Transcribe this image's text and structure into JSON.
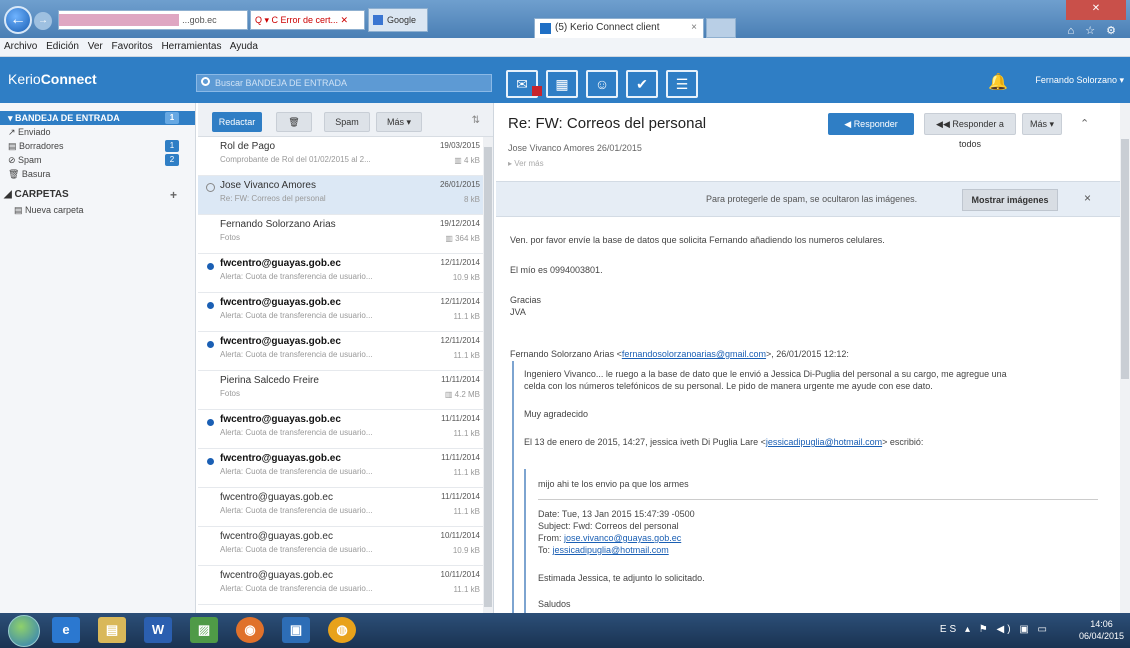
{
  "browser": {
    "address_text": "...gob.ec",
    "address_tools": "Q ▾ C Error de cert... ✕",
    "tab_google": "Google",
    "tab_kerio": "(5) Kerio Connect client",
    "tab_close": "×",
    "back_glyph": "←",
    "forward_glyph": "→"
  },
  "menubar": [
    "Archivo",
    "Edición",
    "Ver",
    "Favoritos",
    "Herramientas",
    "Ayuda"
  ],
  "app": {
    "logo_prefix": "Kerio",
    "logo_suffix": "Connect",
    "search_placeholder": "Buscar BANDEJA DE ENTRADA",
    "user_name": "Fernando Solorzano ▾"
  },
  "sidebar": {
    "folders": [
      {
        "label": "▾ BANDEJA DE ENTRADA",
        "count": "1"
      },
      {
        "label": "↗ Enviado",
        "count": ""
      },
      {
        "label": "▤ Borradores",
        "count": "1"
      },
      {
        "label": "⊘ Spam",
        "count": "2"
      },
      {
        "label": "🗑 Basura",
        "count": ""
      }
    ],
    "section_title": "◢ CARPETAS",
    "section_plus": "+",
    "new_folder": "▤ Nueva carpeta"
  },
  "list_toolbar": {
    "compose": "Redactar",
    "spam": "Spam",
    "mas": "Más ▾",
    "sort": "⇅"
  },
  "messages": [
    {
      "from": "Rol de Pago",
      "preview": "Comprobante de Rol del 01/02/2015 al 2...",
      "date": "19/03/2015",
      "size": "▥ 4 kB",
      "unread": false
    },
    {
      "from": "Jose Vivanco Amores",
      "preview": "Re: FW: Correos del personal",
      "date": "26/01/2015",
      "size": "8 kB",
      "unread": false
    },
    {
      "from": "Fernando Solorzano Arias",
      "preview": "Fotos",
      "date": "19/12/2014",
      "size": "▥ 364 kB",
      "unread": false
    },
    {
      "from": "fwcentro@guayas.gob.ec",
      "preview": "Alerta: Cuota de transferencia de usuario...",
      "date": "12/11/2014",
      "size": "10.9 kB",
      "unread": true
    },
    {
      "from": "fwcentro@guayas.gob.ec",
      "preview": "Alerta: Cuota de transferencia de usuario...",
      "date": "12/11/2014",
      "size": "11.1 kB",
      "unread": true
    },
    {
      "from": "fwcentro@guayas.gob.ec",
      "preview": "Alerta: Cuota de transferencia de usuario...",
      "date": "12/11/2014",
      "size": "11.1 kB",
      "unread": true
    },
    {
      "from": "Pierina Salcedo Freire",
      "preview": "Fotos",
      "date": "11/11/2014",
      "size": "▥ 4.2 MB",
      "unread": false
    },
    {
      "from": "fwcentro@guayas.gob.ec",
      "preview": "Alerta: Cuota de transferencia de usuario...",
      "date": "11/11/2014",
      "size": "11.1 kB",
      "unread": true
    },
    {
      "from": "fwcentro@guayas.gob.ec",
      "preview": "Alerta: Cuota de transferencia de usuario...",
      "date": "11/11/2014",
      "size": "11.1 kB",
      "unread": true
    },
    {
      "from": "fwcentro@guayas.gob.ec",
      "preview": "Alerta: Cuota de transferencia de usuario...",
      "date": "11/11/2014",
      "size": "11.1 kB",
      "unread": false
    },
    {
      "from": "fwcentro@guayas.gob.ec",
      "preview": "Alerta: Cuota de transferencia de usuario...",
      "date": "10/11/2014",
      "size": "10.9 kB",
      "unread": false
    },
    {
      "from": "fwcentro@guayas.gob.ec",
      "preview": "Alerta: Cuota de transferencia de usuario...",
      "date": "10/11/2014",
      "size": "11.1 kB",
      "unread": false
    }
  ],
  "reading": {
    "subject": "Re: FW: Correos del personal",
    "sender": "Jose Vivanco Amores  26/01/2015",
    "ver_mas": "▸ Ver más",
    "reply": "Responder",
    "reply_all": "Responder a todos",
    "mas": "Más ▾",
    "spam_notice": "Para protegerle de spam, se ocultaron las imágenes.",
    "show_images": "Mostrar imágenes",
    "close": "×",
    "body": [
      "Ven. por favor envíe la base de datos que solicita Fernando añadiendo los numeros celulares.",
      "El mío es 0994003801.",
      "Gracias",
      "JVA"
    ],
    "quoted_header_prefix": "Fernando Solorzano Arias <",
    "quoted_header_link": "fernandosolorzanoarias@gmail.com",
    "quoted_header_suffix": ">, 26/01/2015 12:12:",
    "quote_lines": [
      "Ingeniero Vivanco... le ruego a la base de dato que le envió a Jessica Di-Puglia del personal a su cargo, me agregue una",
      "celda con los números telefónicos de su personal. Le pido de manera urgente me ayude con ese dato.",
      "Muy agradecido"
    ],
    "quote2_prefix": "El 13 de enero de 2015, 14:27, jessica iveth Di Puglia Lare <",
    "quote2_link": "jessicadipuglia@hotmail.com",
    "quote2_suffix": "> escribió:",
    "inner": {
      "line1": "mijo ahi te los envio pa que los armes",
      "date": "Date: Tue, 13 Jan 2015 15:47:39 -0500",
      "subject": "Subject: Fwd: Correos del personal",
      "from_label": "From: ",
      "from_link": "jose.vivanco@guayas.gob.ec",
      "to_label": "To: ",
      "to_link": "jessicadipuglia@hotmail.com",
      "greeting": "Estimada Jessica, te adjunto lo solicitado.",
      "closing": "Saludos"
    }
  },
  "taskbar": {
    "tray": "ES ▴ ⚑ ◀) ▣ ▭",
    "time": "14:06",
    "date": "06/04/2015"
  }
}
